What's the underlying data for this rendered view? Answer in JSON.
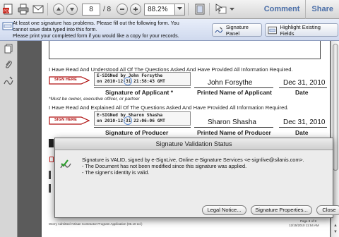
{
  "toolbar": {
    "page_current": "8",
    "page_total": "/ 8",
    "zoom": "88.2%",
    "comment_label": "Comment",
    "share_label": "Share"
  },
  "message_bar": {
    "line1": "At least one signature has problems. Please fill out the following form. You",
    "line2": "cannot save data typed into this form.",
    "line3": "Please print your completed form if you would like a copy for your records.",
    "signature_panel_label": "Signature Panel",
    "highlight_fields_label": "Highlight Existing Fields"
  },
  "document": {
    "statement_applicant": "I Have Read And Understood All Of The Questions Asked And Have Provided All Information Required.",
    "sign_here": "SIGN HERE",
    "esig1_line1": "E-SIGNed by John Forsythe",
    "esig1_line2": "on 2010-12-31 21:58:43 GMT",
    "applicant_name": "John Forsythe",
    "applicant_date": "Dec 31, 2010",
    "label_sig_applicant": "Signature of Applicant *",
    "label_printed_applicant": "Printed Name of Applicant",
    "label_date": "Date",
    "note_owner": "*Must be owner, executive officer, or partner",
    "statement_producer": "I Have Read And Explained All Of The Questions Asked And Have Provided All Information Required.",
    "esig2_line1": "E-SIGNed by Sharon Shasha",
    "esig2_line2": "on 2010-12-31 22:06:06 GMT",
    "producer_name": "Sharon Shasha",
    "producer_date": "Dec 31, 2010",
    "label_sig_producer": "Signature of Producer",
    "label_printed_producer": "Printed Name of Producer",
    "footer_left": "Worry Admitted Artisan Contractor Program Application (06.10 ed.)",
    "footer_right_1": "Page 8 of 8",
    "footer_right_2": "12/15/2010 11:54 AM"
  },
  "dialog": {
    "title": "Signature Validation Status",
    "line1": "Signature is VALID, signed by e-SignLive, Online e-Signature Services <e-signlive@silanis.com>.",
    "line2": "- The Document has not been modified since this signature was applied.",
    "line3": "- The signer's identity is valid.",
    "legal_label": "Legal Notice...",
    "properties_label": "Signature Properties...",
    "close_label": "Close"
  },
  "colors": {
    "accent_link": "#4a6ea8",
    "sign_here_red": "#b01010",
    "esig_circle": "#4a7fd0"
  }
}
